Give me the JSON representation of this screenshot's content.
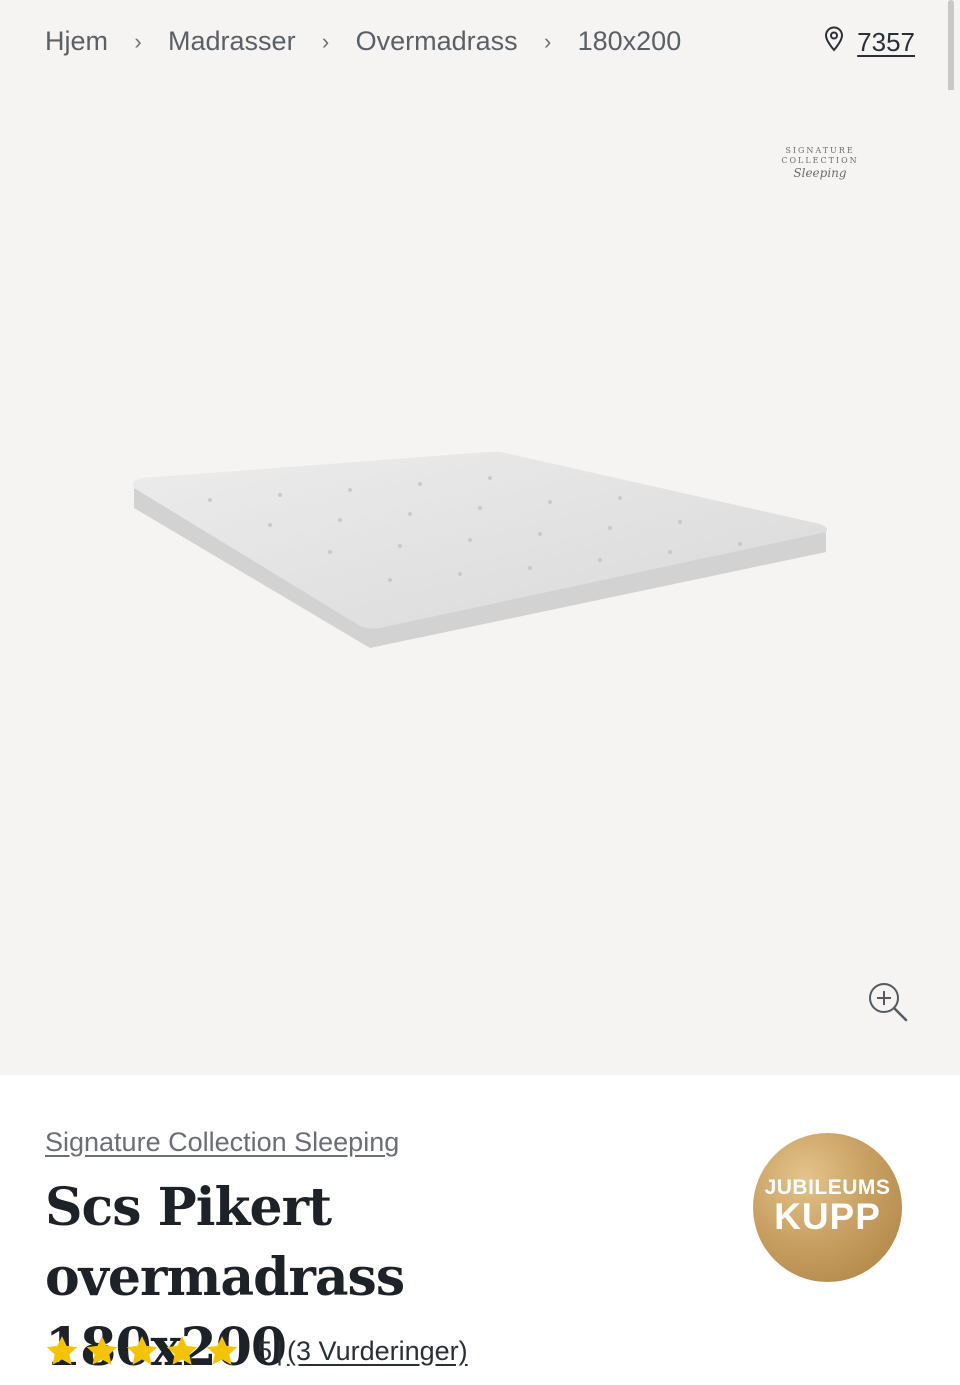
{
  "breadcrumb": {
    "items": [
      {
        "label": "Hjem"
      },
      {
        "label": "Madrasser"
      },
      {
        "label": "Overmadrass"
      },
      {
        "label": "180x200"
      }
    ]
  },
  "store": {
    "icon": "location-pin-icon",
    "number": "7357"
  },
  "gallery": {
    "brand_logo_line1": "SIGNATURE COLLECTION",
    "brand_logo_line2": "Sleeping",
    "zoom_icon": "zoom-in-icon"
  },
  "product": {
    "brand": "Signature Collection Sleeping",
    "title_line1": "Scs Pikert overmadrass",
    "title_line2": "180x200",
    "badge_line1": "JUBILEUMS",
    "badge_line2": "KUPP",
    "rating": {
      "stars": 5,
      "score": "5",
      "separator": "|",
      "reviews_label": "(3 Vurderinger)"
    }
  },
  "colors": {
    "gallery_bg": "#f5f4f2",
    "star": "#f5c400",
    "badge_gold": "#c9a063",
    "title": "#1d2128"
  }
}
